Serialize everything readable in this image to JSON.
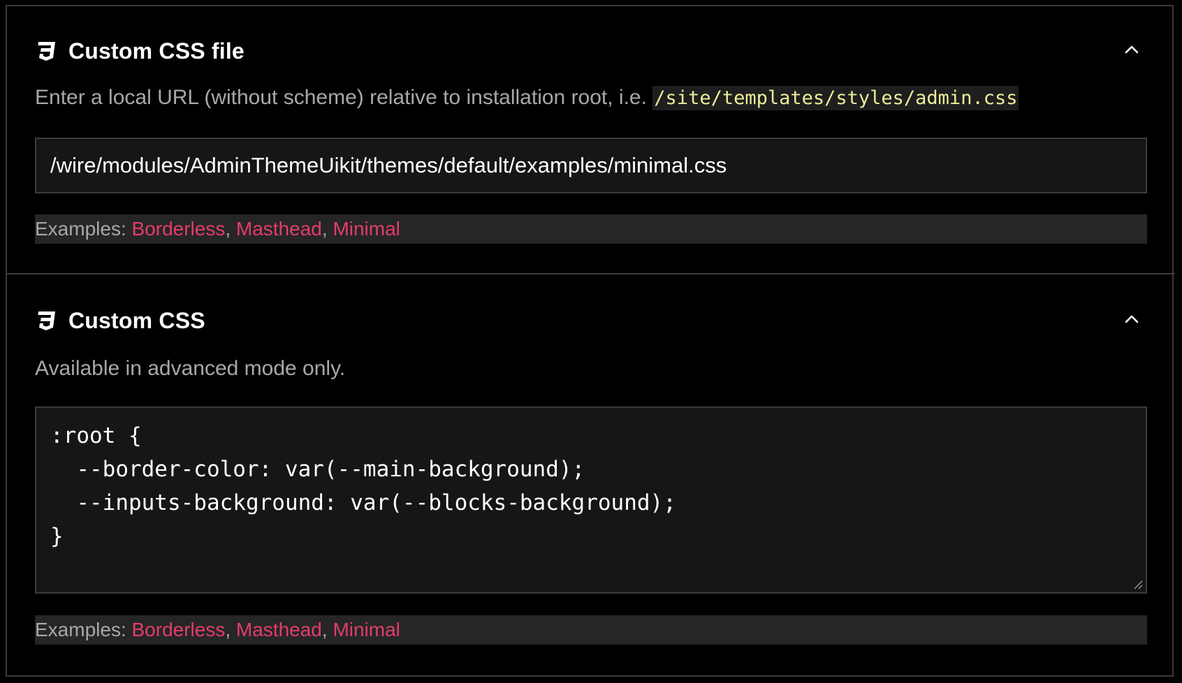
{
  "custom_css_file": {
    "title": "Custom CSS file",
    "description_prefix": "Enter a local URL (without scheme) relative to installation root, i.e.",
    "description_code": "/site/templates/styles/admin.css",
    "input_value": "/wire/modules/AdminThemeUikit/themes/default/examples/minimal.css",
    "examples_label": "Examples:",
    "examples": [
      "Borderless",
      "Masthead",
      "Minimal"
    ],
    "icon": "css3-icon",
    "collapse_icon": "chevron-up-icon"
  },
  "custom_css": {
    "title": "Custom CSS",
    "description": "Available in advanced mode only.",
    "code_lines": [
      ":root {",
      "  --border-color: var(--main-background);",
      "  --inputs-background: var(--blocks-background);",
      "}"
    ],
    "examples_label": "Examples:",
    "examples": [
      "Borderless",
      "Masthead",
      "Minimal"
    ],
    "icon": "css3-icon",
    "collapse_icon": "chevron-up-icon"
  },
  "colors": {
    "background": "#000000",
    "input_background": "#161616",
    "examples_background": "#262626",
    "link": "#e43c6c",
    "code_highlight": "#ecec9a"
  }
}
